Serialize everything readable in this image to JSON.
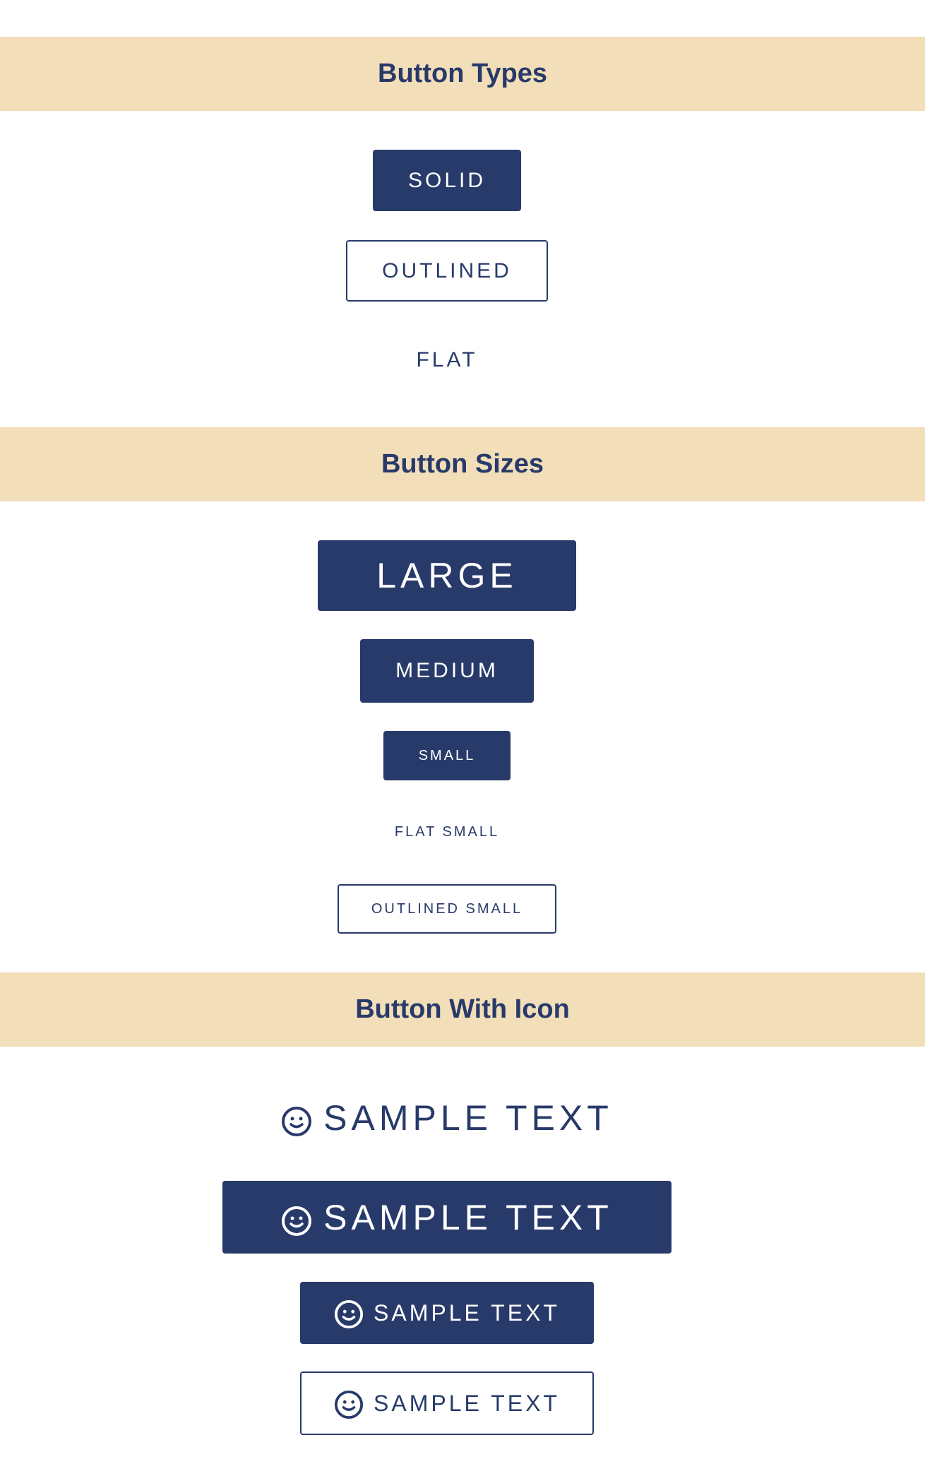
{
  "sections": {
    "types": {
      "title": "Button Types"
    },
    "sizes": {
      "title": "Button Sizes"
    },
    "icon": {
      "title": "Button With Icon"
    }
  },
  "buttons": {
    "solid": "SOLID",
    "outlined": "OUTLINED",
    "flat": "FLAT",
    "large": "LARGE",
    "medium": "MEDIUM",
    "small": "SMALL",
    "flat_small": "FLAT SMALL",
    "outlined_small": "OUTLINED SMALL",
    "icon_flat_large": "SAMPLE TEXT",
    "icon_solid_large": "SAMPLE TEXT",
    "icon_solid_medium": "SAMPLE TEXT",
    "icon_outlined_medium": "SAMPLE TEXT"
  },
  "icons": {
    "button_icon": "smiley-face-icon"
  },
  "colors": {
    "primary": "#283a6a",
    "header_background": "#f2deb8",
    "background": "#ffffff"
  }
}
